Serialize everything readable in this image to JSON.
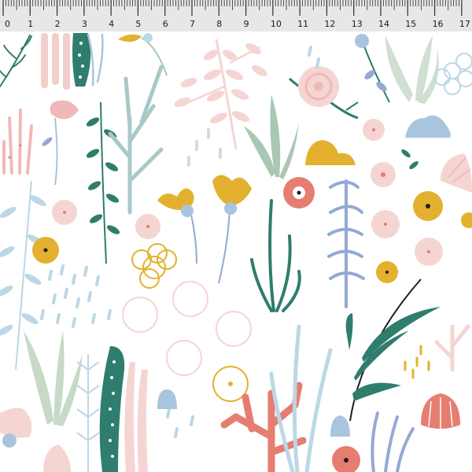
{
  "ruler": {
    "unit_labels": [
      "0",
      "1",
      "2",
      "3",
      "4",
      "5",
      "6",
      "7",
      "8",
      "9",
      "10",
      "11",
      "12",
      "13",
      "14",
      "15",
      "16",
      "17"
    ],
    "background": "#e7e7e7",
    "tick_color": "#2b2b2b"
  },
  "pattern": {
    "background": "#ffffff",
    "palette": {
      "teal": "#2f7d6d",
      "sage": "#a9c8b4",
      "pale_blue": "#a9c4dd",
      "periwinkle": "#94a9d3",
      "light_blue": "#bcd7e6",
      "blush": "#f5d5d2",
      "pink": "#efb9b8",
      "coral": "#e57e70",
      "mustard": "#e3b12f",
      "dark": "#1f1f1f"
    },
    "motifs": [
      "seaweed",
      "coral",
      "shell",
      "snail",
      "flower",
      "rock",
      "kelp"
    ]
  }
}
